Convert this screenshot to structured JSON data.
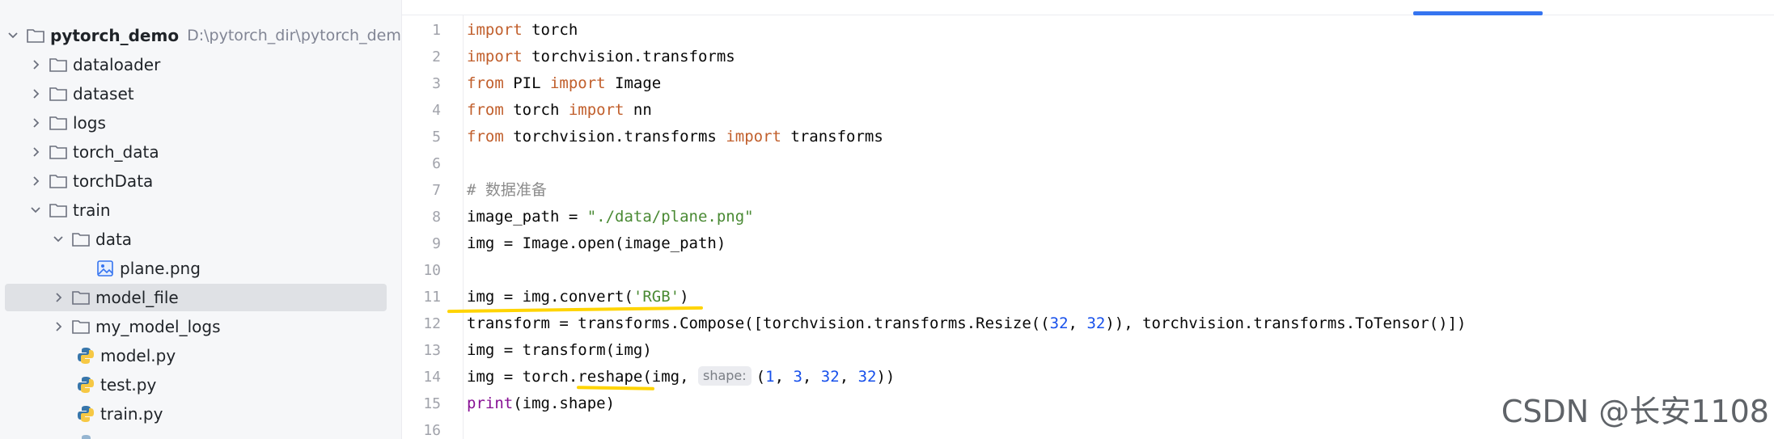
{
  "project": {
    "root_name": "pytorch_demo",
    "root_path": "D:\\pytorch_dir\\pytorch_demo",
    "items": [
      {
        "label": "dataloader"
      },
      {
        "label": "dataset"
      },
      {
        "label": "logs"
      },
      {
        "label": "torch_data"
      },
      {
        "label": "torchData"
      },
      {
        "label": "train"
      },
      {
        "label": "data"
      },
      {
        "label": "plane.png"
      },
      {
        "label": "model_file"
      },
      {
        "label": "my_model_logs"
      },
      {
        "label": "model.py"
      },
      {
        "label": "test.py"
      },
      {
        "label": "train.py"
      }
    ]
  },
  "editor": {
    "line_numbers": [
      "1",
      "2",
      "3",
      "4",
      "5",
      "6",
      "7",
      "8",
      "9",
      "10",
      "11",
      "12",
      "13",
      "14",
      "15",
      "16"
    ],
    "code": {
      "l1": {
        "kw": "import",
        "rest": " torch"
      },
      "l2": {
        "kw": "import",
        "rest": " torchvision.transforms"
      },
      "l3": {
        "kw": "from",
        "mid": " PIL ",
        "kw2": "import",
        "rest": " Image"
      },
      "l4": {
        "kw": "from",
        "mid": " torch ",
        "kw2": "import",
        "rest": " nn"
      },
      "l5": {
        "kw": "from",
        "mid": " torchvision.transforms ",
        "kw2": "import",
        "rest": " transforms"
      },
      "l7": {
        "comment": "# 数据准备"
      },
      "l8": {
        "pre": "image_path = ",
        "str": "\"./data/plane.png\""
      },
      "l9": {
        "text": "img = Image.open(image_path)"
      },
      "l11": {
        "pre": "img = img.convert(",
        "str": "'RGB'",
        "post": ")"
      },
      "l12": {
        "pre": "transform = transforms.Compose([torchvision.transforms.Resize((",
        "n1": "32",
        "sep": ", ",
        "n2": "32",
        "post": ")), torchvision.transforms.ToTensor()])"
      },
      "l13": {
        "text": "img = transform(img)"
      },
      "l14": {
        "pre": "img = torch.reshape(img, ",
        "hint": "shape:",
        "open": "(",
        "n1": "1",
        "n2": "3",
        "n3": "32",
        "n4": "32",
        "close": "))",
        "sep": ", "
      },
      "l15": {
        "fn": "print",
        "rest": "(img.shape)"
      }
    }
  },
  "watermark": "CSDN @长安1108",
  "colors": {
    "accent": "#3574f0",
    "keyword": "#c15f2c",
    "string": "#4a8a34",
    "number": "#1750eb",
    "underline_marks": "#ffd400"
  }
}
